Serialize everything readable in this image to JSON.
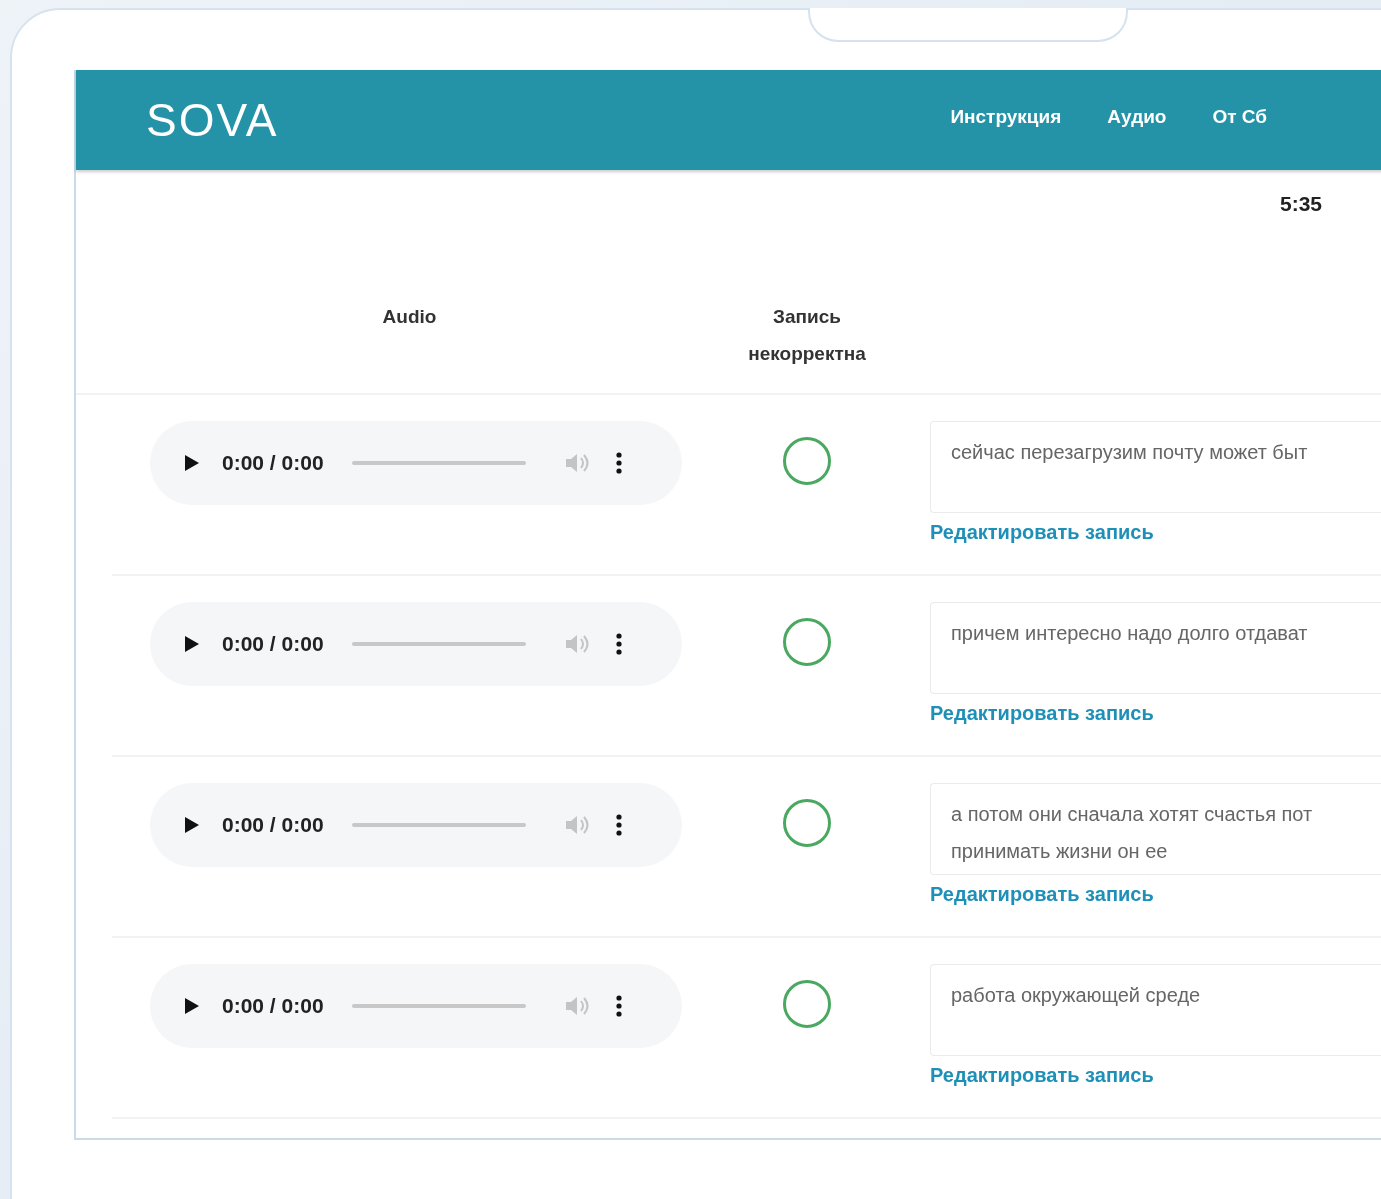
{
  "header": {
    "logo": "SOVA",
    "nav": [
      "Инструкция",
      "Аудио",
      "От Сб"
    ]
  },
  "timer": "5:35",
  "table": {
    "columns": [
      "Audio",
      "Запись некорректна"
    ],
    "rows": [
      {
        "player": {
          "time": "0:00 / 0:00"
        },
        "incorrect": false,
        "text": "сейчас перезагрузим почту может быт",
        "edit_link": "Редактировать запись"
      },
      {
        "player": {
          "time": "0:00 / 0:00"
        },
        "incorrect": false,
        "text": "причем интересно надо долго отдават",
        "edit_link": "Редактировать запись"
      },
      {
        "player": {
          "time": "0:00 / 0:00"
        },
        "incorrect": false,
        "text": "а потом они сначала хотят счастья пот\nпринимать жизни он ее",
        "edit_link": "Редактировать запись"
      },
      {
        "player": {
          "time": "0:00 / 0:00"
        },
        "incorrect": false,
        "text": "работа окружающей среде",
        "edit_link": "Редактировать запись"
      }
    ]
  }
}
